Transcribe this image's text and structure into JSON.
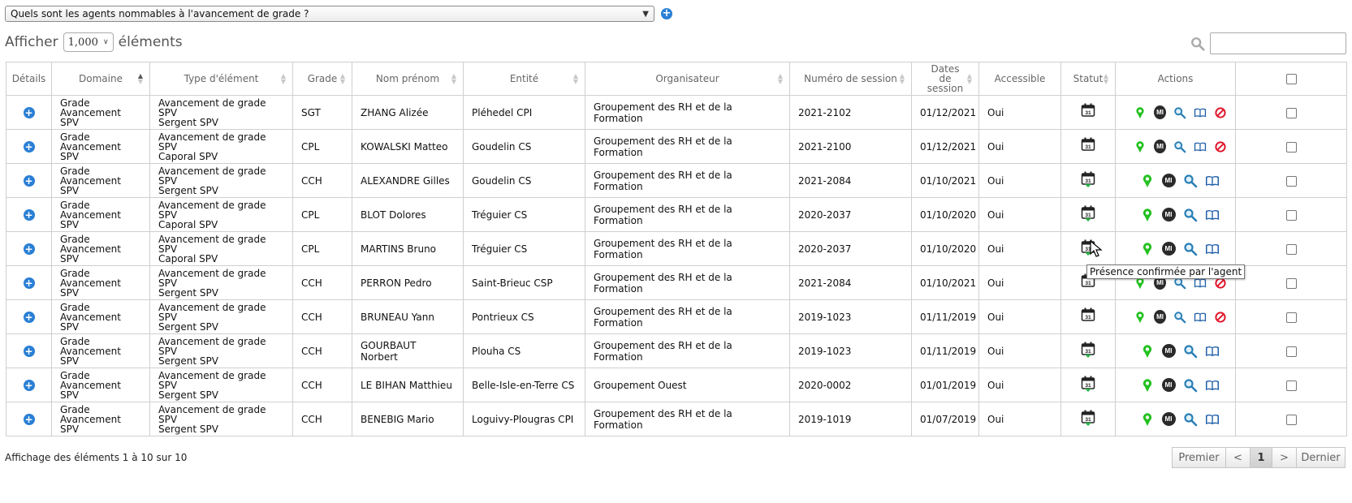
{
  "query": {
    "selected": "Quels sont les agents nommables à l'avancement de grade ?"
  },
  "length": {
    "prefix": "Afficher",
    "value": "1,000",
    "suffix": "éléments"
  },
  "search": {
    "placeholder": ""
  },
  "columns": [
    "Détails",
    "Domaine",
    "Type d'élément",
    "Grade",
    "Nom prénom",
    "Entité",
    "Organisateur",
    "Numéro de session",
    "Dates de session",
    "Accessible",
    "Statut",
    "Actions"
  ],
  "rows": [
    {
      "domaine1": "Grade",
      "domaine2": "Avancement SPV",
      "type1": "Avancement de grade SPV",
      "type2": "Sergent SPV",
      "grade": "SGT",
      "nom": "ZHANG Alizée",
      "entite": "Pléhedel CPI",
      "organisateur": "Groupement des RH et de la Formation",
      "session": "2021-2102",
      "date": "01/12/2021",
      "accessible": "Oui",
      "statut": "calendar",
      "full": true
    },
    {
      "domaine1": "Grade",
      "domaine2": "Avancement SPV",
      "type1": "Avancement de grade SPV",
      "type2": "Caporal SPV",
      "grade": "CPL",
      "nom": "KOWALSKI Matteo",
      "entite": "Goudelin CS",
      "organisateur": "Groupement des RH et de la Formation",
      "session": "2021-2100",
      "date": "01/12/2021",
      "accessible": "Oui",
      "statut": "calendar",
      "full": true
    },
    {
      "domaine1": "Grade",
      "domaine2": "Avancement SPV",
      "type1": "Avancement de grade SPV",
      "type2": "Sergent SPV",
      "grade": "CCH",
      "nom": "ALEXANDRE Gilles",
      "entite": "Goudelin CS",
      "organisateur": "Groupement des RH et de la Formation",
      "session": "2021-2084",
      "date": "01/10/2021",
      "accessible": "Oui",
      "statut": "confirmed",
      "full": false
    },
    {
      "domaine1": "Grade",
      "domaine2": "Avancement SPV",
      "type1": "Avancement de grade SPV",
      "type2": "Caporal SPV",
      "grade": "CPL",
      "nom": "BLOT Dolores",
      "entite": "Tréguier CS",
      "organisateur": "Groupement des RH et de la Formation",
      "session": "2020-2037",
      "date": "01/10/2020",
      "accessible": "Oui",
      "statut": "confirmed",
      "full": false
    },
    {
      "domaine1": "Grade",
      "domaine2": "Avancement SPV",
      "type1": "Avancement de grade SPV",
      "type2": "Caporal SPV",
      "grade": "CPL",
      "nom": "MARTINS Bruno",
      "entite": "Tréguier CS",
      "organisateur": "Groupement des RH et de la Formation",
      "session": "2020-2037",
      "date": "01/10/2020",
      "accessible": "Oui",
      "statut": "confirmed",
      "full": false
    },
    {
      "domaine1": "Grade",
      "domaine2": "Avancement SPV",
      "type1": "Avancement de grade SPV",
      "type2": "Sergent SPV",
      "grade": "CCH",
      "nom": "PERRON Pedro",
      "entite": "Saint-Brieuc CSP",
      "organisateur": "Groupement des RH et de la Formation",
      "session": "2021-2084",
      "date": "01/10/2021",
      "accessible": "Oui",
      "statut": "calendar",
      "full": true
    },
    {
      "domaine1": "Grade",
      "domaine2": "Avancement SPV",
      "type1": "Avancement de grade SPV",
      "type2": "Sergent SPV",
      "grade": "CCH",
      "nom": "BRUNEAU Yann",
      "entite": "Pontrieux CS",
      "organisateur": "Groupement des RH et de la Formation",
      "session": "2019-1023",
      "date": "01/11/2019",
      "accessible": "Oui",
      "statut": "calendar",
      "full": true
    },
    {
      "domaine1": "Grade",
      "domaine2": "Avancement SPV",
      "type1": "Avancement de grade SPV",
      "type2": "Sergent SPV",
      "grade": "CCH",
      "nom": "GOURBAUT Norbert",
      "entite": "Plouha CS",
      "organisateur": "Groupement des RH et de la Formation",
      "session": "2019-1023",
      "date": "01/11/2019",
      "accessible": "Oui",
      "statut": "confirmed",
      "full": false
    },
    {
      "domaine1": "Grade",
      "domaine2": "Avancement SPV",
      "type1": "Avancement de grade SPV",
      "type2": "Sergent SPV",
      "grade": "CCH",
      "nom": "LE BIHAN Matthieu",
      "entite": "Belle-Isle-en-Terre CS",
      "organisateur": "Groupement Ouest",
      "session": "2020-0002",
      "date": "01/01/2019",
      "accessible": "Oui",
      "statut": "confirmed",
      "full": false
    },
    {
      "domaine1": "Grade",
      "domaine2": "Avancement SPV",
      "type1": "Avancement de grade SPV",
      "type2": "Sergent SPV",
      "grade": "CCH",
      "nom": "BENEBIG Mario",
      "entite": "Loguivy-Plougras CPI",
      "organisateur": "Groupement des RH et de la Formation",
      "session": "2019-1019",
      "date": "01/07/2019",
      "accessible": "Oui",
      "statut": "confirmed",
      "full": false
    }
  ],
  "icons": {
    "mi_label": "MI",
    "calendar_day": "31"
  },
  "tooltip": "Présence confirmée par l'agent",
  "info": "Affichage des éléments 1 à 10 sur 10",
  "pager": {
    "first": "Premier",
    "prev": "<",
    "current": "1",
    "next": ">",
    "last": "Dernier"
  },
  "colors": {
    "accent_blue": "#2a7fd4",
    "pin_green": "#22c11f",
    "confirm_green": "#2ab34a",
    "cancel_red": "#e0162b"
  }
}
